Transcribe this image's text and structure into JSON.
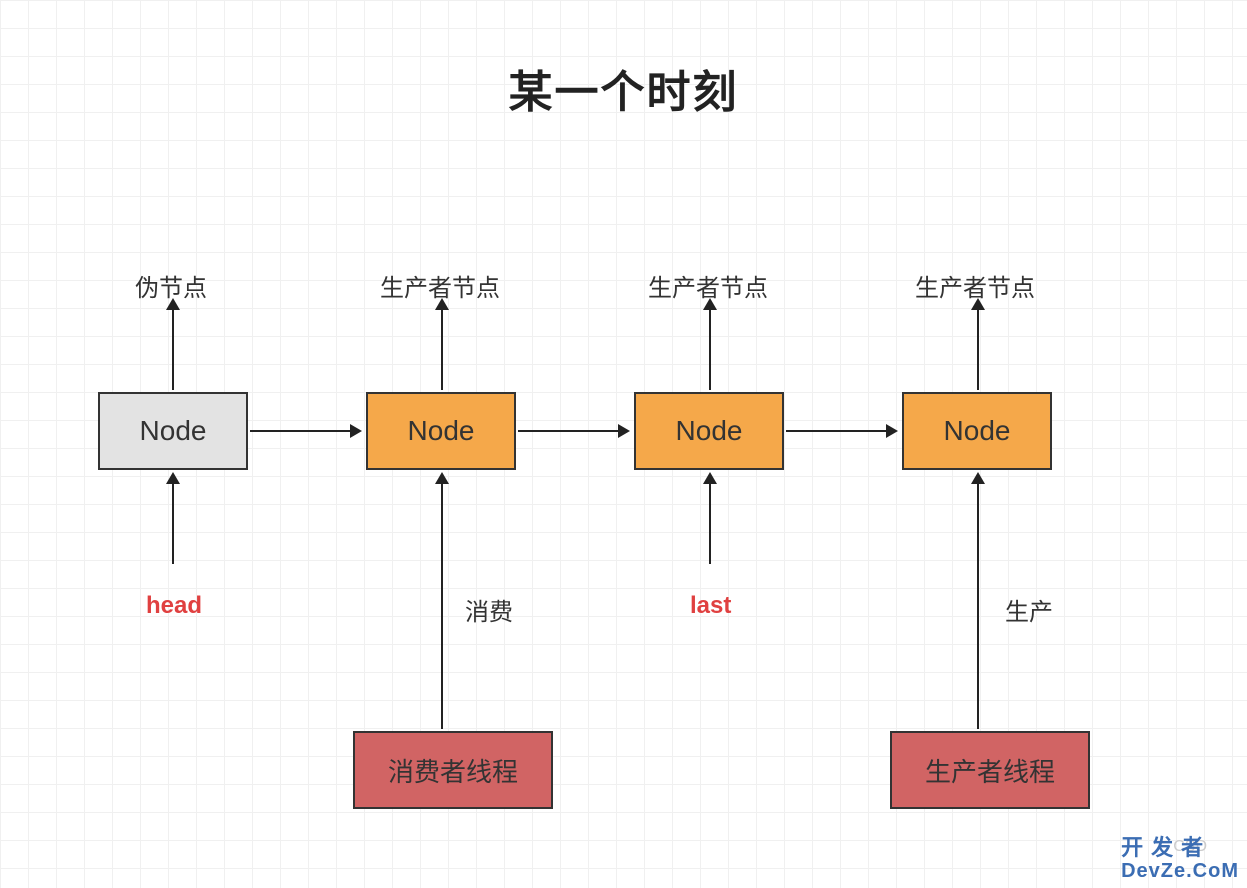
{
  "title": "某一个时刻",
  "nodes": {
    "n1": "Node",
    "n2": "Node",
    "n3": "Node",
    "n4": "Node"
  },
  "top_labels": {
    "t1": "伪节点",
    "t2": "生产者节点",
    "t3": "生产者节点",
    "t4": "生产者节点"
  },
  "bottom_labels": {
    "head": "head",
    "last": "last",
    "consume": "消费",
    "produce": "生产"
  },
  "threads": {
    "consumer": "消费者线程",
    "producer": "生产者线程"
  },
  "watermark": {
    "line1": "开发者",
    "line2": "DevZe.CoM",
    "faint": "CSD"
  }
}
